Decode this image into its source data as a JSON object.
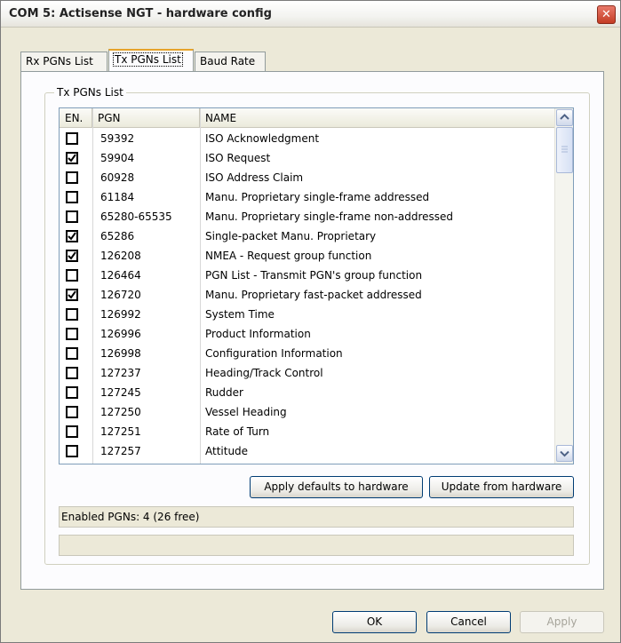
{
  "window": {
    "title": "COM 5: Actisense NGT - hardware config",
    "close_label": "✕"
  },
  "tabs": [
    {
      "label": "Rx PGNs List",
      "active": false
    },
    {
      "label": "Tx PGNs List",
      "active": true
    },
    {
      "label": "Baud Rate",
      "active": false
    }
  ],
  "group": {
    "label": "Tx PGNs List"
  },
  "table": {
    "columns": [
      "EN.",
      "PGN",
      "NAME"
    ],
    "rows": [
      {
        "enabled": false,
        "pgn": "59392",
        "name": "ISO Acknowledgment"
      },
      {
        "enabled": true,
        "pgn": "59904",
        "name": "ISO Request"
      },
      {
        "enabled": false,
        "pgn": "60928",
        "name": "ISO Address Claim"
      },
      {
        "enabled": false,
        "pgn": "61184",
        "name": "Manu. Proprietary single-frame addressed"
      },
      {
        "enabled": false,
        "pgn": "65280-65535",
        "name": "Manu. Proprietary single-frame non-addressed"
      },
      {
        "enabled": true,
        "pgn": "65286",
        "name": "Single-packet Manu. Proprietary"
      },
      {
        "enabled": true,
        "pgn": "126208",
        "name": "NMEA -  Request group function"
      },
      {
        "enabled": false,
        "pgn": "126464",
        "name": "PGN List - Transmit PGN's group function"
      },
      {
        "enabled": true,
        "pgn": "126720",
        "name": "Manu. Proprietary fast-packet addressed"
      },
      {
        "enabled": false,
        "pgn": "126992",
        "name": "System Time"
      },
      {
        "enabled": false,
        "pgn": "126996",
        "name": "Product Information"
      },
      {
        "enabled": false,
        "pgn": "126998",
        "name": "Configuration Information"
      },
      {
        "enabled": false,
        "pgn": "127237",
        "name": "Heading/Track Control"
      },
      {
        "enabled": false,
        "pgn": "127245",
        "name": "Rudder"
      },
      {
        "enabled": false,
        "pgn": "127250",
        "name": "Vessel Heading"
      },
      {
        "enabled": false,
        "pgn": "127251",
        "name": "Rate of Turn"
      },
      {
        "enabled": false,
        "pgn": "127257",
        "name": "Attitude"
      }
    ]
  },
  "buttons": {
    "apply_defaults": "Apply defaults to hardware",
    "update_from_hw": "Update from hardware",
    "ok": "OK",
    "cancel": "Cancel",
    "apply": "Apply"
  },
  "status": {
    "enabled_text": "Enabled PGNs: 4 (26 free)",
    "secondary_text": ""
  },
  "icons": {
    "scroll_up": "chevron-up-icon",
    "scroll_down": "chevron-down-icon",
    "checkbox_check": "check-icon"
  }
}
